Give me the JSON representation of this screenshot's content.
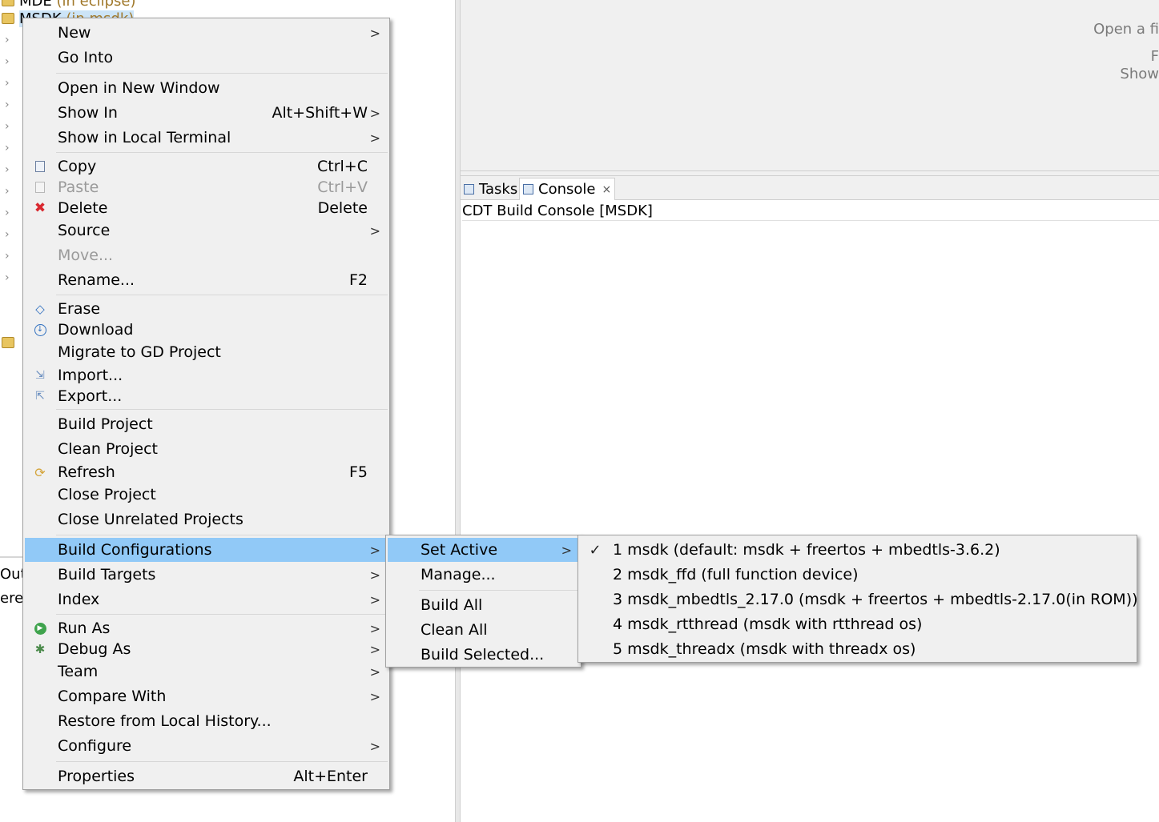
{
  "explorer": {
    "top_project": {
      "name": "MDE",
      "suffix": " (in eclipse)"
    },
    "selected_project": {
      "name": "MSDK",
      "suffix": " (in msdk)"
    },
    "outline_tab": "Out",
    "outline_text": "ere"
  },
  "editor": {
    "hint_line1": "Open a fi",
    "hint_line2": "F",
    "hint_line3": "Show"
  },
  "console": {
    "tabs": [
      {
        "label": "Tasks",
        "icon": "tasks-icon"
      },
      {
        "label": "Console",
        "icon": "console-icon",
        "active": true,
        "close": "×"
      }
    ],
    "title": "CDT Build Console [MSDK]"
  },
  "context_menu": {
    "items": [
      {
        "label": "New",
        "arrow": ">"
      },
      {
        "label": "Go Into"
      },
      {
        "label": "Open in New Window"
      },
      {
        "label": "Show In",
        "accel": "Alt+Shift+W",
        "arrow": ">"
      },
      {
        "label": "Show in Local Terminal",
        "arrow": ">"
      },
      {
        "label": "Copy",
        "accel": "Ctrl+C",
        "icon": "copy-icon"
      },
      {
        "label": "Paste",
        "accel": "Ctrl+V",
        "icon": "paste-icon",
        "disabled": true
      },
      {
        "label": "Delete",
        "accel": "Delete",
        "icon": "delete-icon"
      },
      {
        "label": "Source",
        "arrow": ">"
      },
      {
        "label": "Move...",
        "disabled": true
      },
      {
        "label": "Rename...",
        "accel": "F2"
      },
      {
        "label": "Erase",
        "icon": "erase-icon"
      },
      {
        "label": "Download",
        "icon": "download-icon"
      },
      {
        "label": "Migrate to GD Project"
      },
      {
        "label": "Import...",
        "icon": "import-icon"
      },
      {
        "label": "Export...",
        "icon": "export-icon"
      },
      {
        "label": "Build Project"
      },
      {
        "label": "Clean Project"
      },
      {
        "label": "Refresh",
        "accel": "F5",
        "icon": "refresh-icon"
      },
      {
        "label": "Close Project"
      },
      {
        "label": "Close Unrelated Projects"
      },
      {
        "label": "Build Configurations",
        "arrow": ">",
        "highlighted": true
      },
      {
        "label": "Build Targets",
        "arrow": ">"
      },
      {
        "label": "Index",
        "arrow": ">"
      },
      {
        "label": "Run As",
        "arrow": ">",
        "icon": "run-icon"
      },
      {
        "label": "Debug As",
        "arrow": ">",
        "icon": "debug-icon"
      },
      {
        "label": "Team",
        "arrow": ">"
      },
      {
        "label": "Compare With",
        "arrow": ">"
      },
      {
        "label": "Restore from Local History..."
      },
      {
        "label": "Configure",
        "arrow": ">"
      },
      {
        "label": "Properties",
        "accel": "Alt+Enter"
      }
    ]
  },
  "build_config_menu": {
    "items": [
      {
        "label": "Set Active",
        "arrow": ">",
        "highlighted": true
      },
      {
        "label": "Manage..."
      },
      {
        "label": "Build All"
      },
      {
        "label": "Clean All"
      },
      {
        "label": "Build Selected..."
      }
    ]
  },
  "set_active_menu": {
    "check": "✓",
    "items": [
      {
        "label": "1 msdk (default: msdk + freertos + mbedtls-3.6.2)",
        "checked": true
      },
      {
        "label": "2 msdk_ffd (full function device)"
      },
      {
        "label": "3 msdk_mbedtls_2.17.0 (msdk + freertos + mbedtls-2.17.0(in ROM))"
      },
      {
        "label": "4 msdk_rtthread (msdk with rtthread os)"
      },
      {
        "label": "5 msdk_threadx (msdk with threadx os)"
      }
    ]
  }
}
